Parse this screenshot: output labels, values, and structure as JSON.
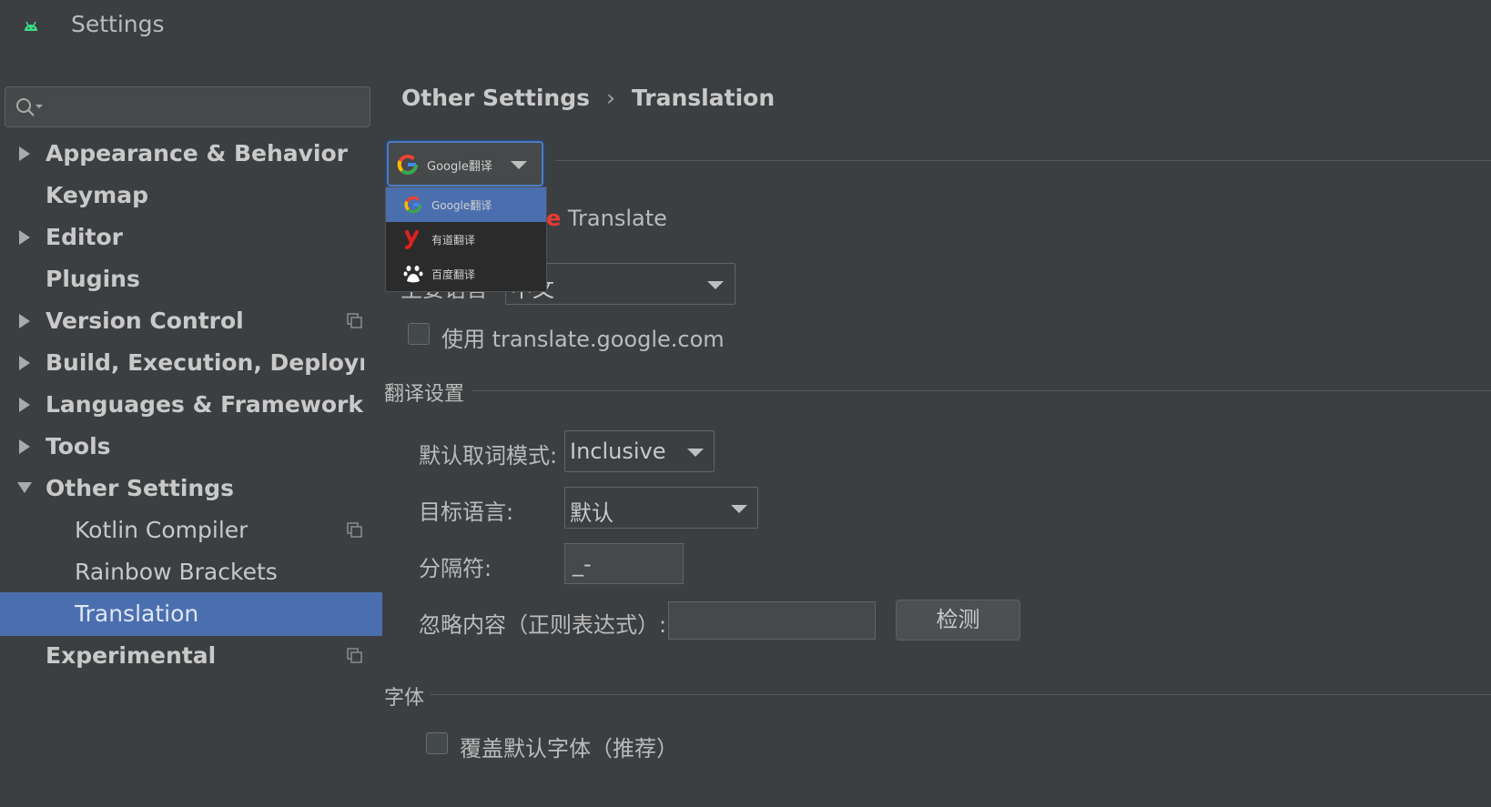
{
  "window": {
    "title": "Settings",
    "app_icon": "android-icon"
  },
  "sidebar": {
    "search": {
      "placeholder": "",
      "icon": "search-icon"
    },
    "items": [
      {
        "label": "Appearance & Behavior",
        "expandable": true,
        "expanded": false
      },
      {
        "label": "Keymap",
        "expandable": false
      },
      {
        "label": "Editor",
        "expandable": true,
        "expanded": false
      },
      {
        "label": "Plugins",
        "expandable": false
      },
      {
        "label": "Version Control",
        "expandable": true,
        "expanded": false,
        "project_icon": true
      },
      {
        "label": "Build, Execution, Deployment",
        "expandable": true,
        "expanded": false
      },
      {
        "label": "Languages & Frameworks",
        "expandable": true,
        "expanded": false
      },
      {
        "label": "Tools",
        "expandable": true,
        "expanded": false
      },
      {
        "label": "Other Settings",
        "expandable": true,
        "expanded": true
      },
      {
        "label": "Kotlin Compiler",
        "child": true,
        "project_icon": true
      },
      {
        "label": "Rainbow Brackets",
        "child": true
      },
      {
        "label": "Translation",
        "child": true,
        "selected": true
      },
      {
        "label": "Experimental",
        "expandable": false,
        "project_icon": true
      }
    ]
  },
  "breadcrumb": {
    "parent": "Other Settings",
    "separator": "›",
    "current": "Translation"
  },
  "engine": {
    "selected": "Google翻译",
    "options": [
      {
        "label": "Google翻译",
        "icon": "google-icon",
        "selected": true
      },
      {
        "label": "有道翻译",
        "icon": "youdao-icon"
      },
      {
        "label": "百度翻译",
        "icon": "baidu-icon"
      }
    ]
  },
  "google_section": {
    "header_visible_part": "e",
    "header_text": "Translate",
    "primary_language_value": "中文",
    "use_google_com_label": "使用 translate.google.com",
    "use_google_com_checked": false
  },
  "translate_settings": {
    "title": "翻译设置",
    "word_mode_label": "默认取词模式:",
    "word_mode_value": "Inclusive",
    "target_lang_label": "目标语言:",
    "target_lang_value": "默认",
    "separator_label": "分隔符:",
    "separator_value": "_-",
    "ignore_label": "忽略内容（正则表达式）:",
    "ignore_value": "",
    "check_button": "检测"
  },
  "font_section": {
    "title": "字体",
    "override_label": "覆盖默认字体（推荐）",
    "override_checked": false
  },
  "colors": {
    "selection": "#4b6eaf",
    "background": "#3c3f41",
    "focus": "#4c7cc4"
  }
}
